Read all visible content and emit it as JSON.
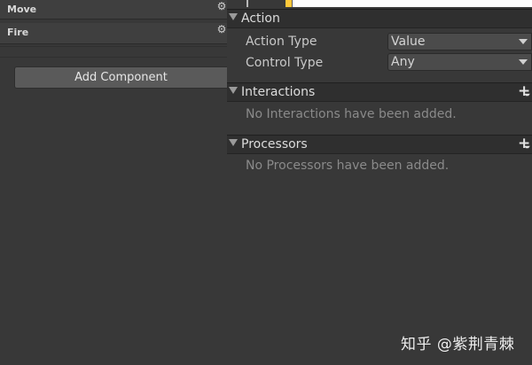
{
  "left_panel": {
    "components": [
      {
        "title": "Move",
        "icon": "gear-icon"
      },
      {
        "title": "Fire",
        "icon": "gear-icon"
      }
    ],
    "add_component_label": "Add Component"
  },
  "right_panel": {
    "action": {
      "title": "Action",
      "properties": [
        {
          "label": "Action Type",
          "value": "Value"
        },
        {
          "label": "Control Type",
          "value": "Any"
        }
      ]
    },
    "interactions": {
      "title": "Interactions",
      "empty_text": "No Interactions have been added.",
      "add_icon": "plus-icon"
    },
    "processors": {
      "title": "Processors",
      "empty_text": "No Processors have been added.",
      "add_icon": "plus-icon"
    }
  },
  "watermark": {
    "text": "知乎 @紫荆青棘"
  },
  "colors": {
    "background": "#383838",
    "section_header": "#2f2f2f",
    "dropdown_bg": "#4b4b4b",
    "button_bg": "#5a5a5a",
    "accent_yellow": "#ffc83a",
    "text_primary": "#d2d2d2",
    "text_muted": "#8a8a8a"
  }
}
